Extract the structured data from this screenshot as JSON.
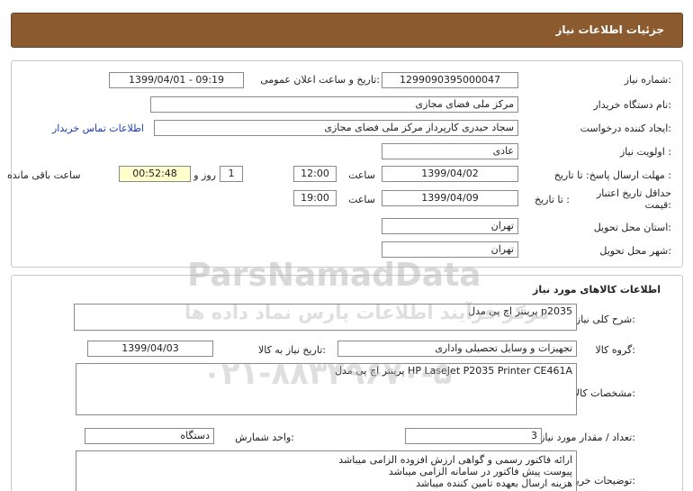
{
  "header": {
    "title": "جزئیات اطلاعات نیاز"
  },
  "general": {
    "need_number_label": "شماره نیاز:",
    "need_number": "1299090395000047",
    "announce_label": "تاریخ و ساعت اعلان عمومی:",
    "announce_value": "1399/04/01 - 09:19",
    "buyer_org_label": "نام دستگاه خریدار:",
    "buyer_org": "مرکز ملی فضای مجازی",
    "requester_label": "ایجاد کننده درخواست:",
    "requester": "سجاد حیدری کارپرداز مرکز ملی فضای مجازی",
    "contact_link": "اطلاعات تماس خریدار",
    "priority_label": "اولویت نیاز :",
    "priority": "عادی",
    "reply_deadline_label": "مهلت ارسال پاسخ: تا تاریخ :",
    "reply_date": "1399/04/02",
    "time_label_1": "ساعت",
    "reply_time": "12:00",
    "days_value": "1",
    "days_label": "روز و",
    "remaining_time": "00:52:48",
    "remaining_label": "ساعت باقی مانده",
    "validity_label": "حداقل تاریخ اعتبار قیمت:",
    "validity_date_label": "تا تاریخ :",
    "validity_date": "1399/04/09",
    "time_label_2": "ساعت",
    "validity_time": "19:00",
    "province_label": "استان محل تحویل:",
    "province": "تهران",
    "city_label": "شهر محل تحویل:",
    "city": "تهران"
  },
  "goods": {
    "section_title": "اطلاعات کالاهای مورد نیاز",
    "summary_label": "شرح کلی نیاز:",
    "summary": "پرینتر اچ پی مدل p2035",
    "group_label": "گروه کالا:",
    "group": "تجهیزات و وسایل تحصیلی واداری",
    "need_date_label": "تاریخ نیاز به کالا:",
    "need_date": "1399/04/03",
    "specs_label": "مشخصات کالای مورد نیاز:",
    "specs": "پرینتر اچ پی مدل HP LaseJet P2035 Printer CE461A",
    "qty_label": "تعداد / مقدار مورد نیاز:",
    "qty": "3",
    "unit_label": "واحد شمارش:",
    "unit": "دستگاه",
    "notes_label": "توضیحات خریدار:",
    "notes": [
      "ارائه فاکتور رسمی و گواهی ارزش افزوده الزامی میباشد",
      "پیوست پیش فاکتور در سامانه الزامی میباشد",
      "هزینه ارسال بعهده تامین کننده میباشد"
    ]
  },
  "watermark": {
    "brand": "ParsNamadData",
    "tagline": "مرکز فرآیند اطلاعات پارس نماد داده ها",
    "phone": "۰۲۱-۸۸۳۴۹۶۷۰-۵"
  }
}
